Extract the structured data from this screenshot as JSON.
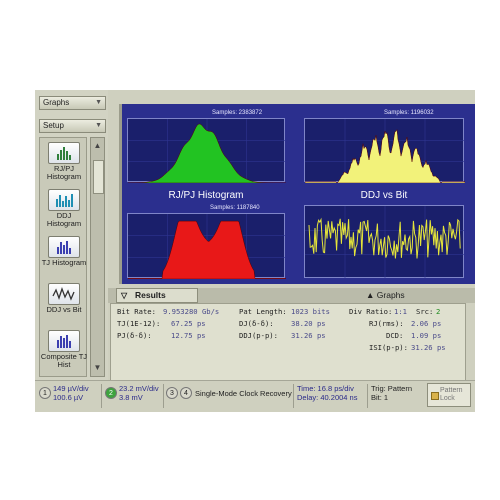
{
  "left_panel": {
    "dropdown_top": "Graphs",
    "dropdown_setup": "Setup",
    "nav_items": [
      {
        "label": "RJ/PJ Histogram",
        "icon": "rj-pj-histogram-icon"
      },
      {
        "label": "DDJ Histogram",
        "icon": "ddj-histogram-icon"
      },
      {
        "label": "TJ Histogram",
        "icon": "tj-histogram-icon"
      },
      {
        "label": "DDJ vs Bit",
        "icon": "ddj-vs-bit-icon"
      },
      {
        "label": "Composite TJ Hist",
        "icon": "composite-tj-histogram-icon"
      }
    ]
  },
  "graphs": {
    "plots": [
      {
        "samples": "Samples: 2383872",
        "title": "",
        "color": "#22c322",
        "shape": "bell"
      },
      {
        "samples": "Samples: 1196032",
        "title": "",
        "color": "#f2f27a",
        "shape": "spiky"
      },
      {
        "samples": "Samples: 1187840",
        "title": "RJ/PJ Histogram",
        "color": "#e81818",
        "shape": "double"
      },
      {
        "samples": "",
        "title": "DDJ vs Bit",
        "color": "#e6e63a",
        "shape": "noise"
      }
    ]
  },
  "results_bar": {
    "tab_label": "Results",
    "graphs_button": "Graphs"
  },
  "results": {
    "rows": [
      [
        {
          "label": "Bit Rate:",
          "value": "9.953280 Gb/s"
        },
        {
          "label": "Pat Length:",
          "value": "1023 bits"
        },
        {
          "label": "Div Ratio:",
          "value": "1:1"
        },
        {
          "label": "Src:",
          "value": "2"
        }
      ],
      [
        {
          "label": "TJ(1E-12):",
          "value": "67.25 ps"
        },
        {
          "label": "DJ(δ-δ):",
          "value": "38.20 ps"
        },
        {
          "label": "RJ(rms):",
          "value": "2.06 ps"
        }
      ],
      [
        {
          "label": "PJ(δ-δ):",
          "value": "12.75 ps"
        },
        {
          "label": "DDJ(p-p):",
          "value": "31.26 ps"
        },
        {
          "label": "DCD:",
          "value": "1.09 ps"
        }
      ],
      [
        {
          "label": "ISI(p-p):",
          "value": "31.26 ps"
        }
      ]
    ]
  },
  "status": {
    "ch1_num": "1",
    "ch1_line1": "149 µV/div",
    "ch1_line2": "100.6 µV",
    "ch2_num": "2",
    "ch2_line1": "23.2 mV/div",
    "ch2_line2": "3.8 mV",
    "ch3_num": "3",
    "ch4_num": "4",
    "mode": "Single-Mode Clock Recovery",
    "time": "Time: 16.8 ps/div",
    "delay": "Delay: 40.2004 ns",
    "trig": "Trig: Pattern",
    "bit": "Bit: 1",
    "lock_line1": "Pattern",
    "lock_line2": "Lock"
  },
  "colors": {
    "graph_bg": "#2b2f8e",
    "panel": "#cfd0bf",
    "accent_green": "#3ea33e"
  }
}
